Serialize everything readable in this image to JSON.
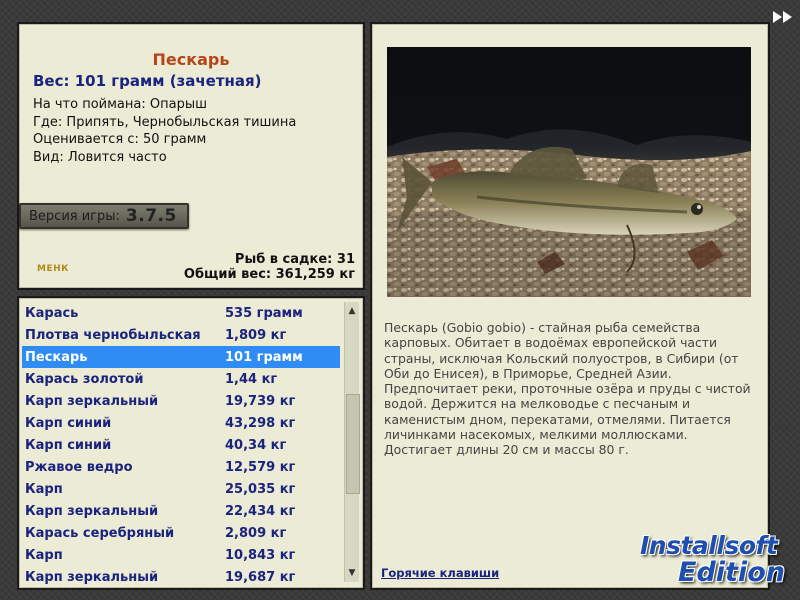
{
  "info": {
    "fish_name": "Пескарь",
    "weight_line": "Вес: 101 грамм (зачетная)",
    "caught_on": "На что поймана: Опарыш",
    "location": "Где: Припять, Чернобыльская тишина",
    "rated_from": "Оценивается с: 50 грамм",
    "frequency": "Вид: Ловится часто",
    "version_label": "Версия игры:",
    "version": "3.7.5",
    "fish_in_keepnet": "Рыб в садке: 31",
    "total_weight": "Общий вес: 361,259 кг",
    "logo_text": "МЕНК"
  },
  "catch_list": [
    {
      "name": "Карась",
      "weight": "535 грамм"
    },
    {
      "name": "Плотва чернобыльская",
      "weight": "1,809 кг"
    },
    {
      "name": "Пескарь",
      "weight": "101 грамм",
      "selected": true
    },
    {
      "name": "Карась золотой",
      "weight": "1,44 кг"
    },
    {
      "name": "Карп зеркальный",
      "weight": "19,739 кг"
    },
    {
      "name": "Карп синий",
      "weight": "43,298 кг"
    },
    {
      "name": "Карп синий",
      "weight": "40,34 кг"
    },
    {
      "name": "Ржавое ведро",
      "weight": "12,579 кг"
    },
    {
      "name": "Карп",
      "weight": "25,035 кг"
    },
    {
      "name": "Карп зеркальный",
      "weight": "22,434 кг"
    },
    {
      "name": "Карась серебряный",
      "weight": "2,809 кг"
    },
    {
      "name": "Карп",
      "weight": "10,843 кг"
    },
    {
      "name": "Карп зеркальный",
      "weight": "19,687 кг"
    }
  ],
  "detail": {
    "description": "Пескарь (Gobio gobio) - стайная рыба семейства карповых. Обитает в водоёмах европейской части страны, исключая Кольский полуостров, в Сибири (от Оби до Енисея), в Приморье, Средней Азии. Предпочитает реки, проточные озёра и пруды с чистой водой. Держится на мелководье с песчаным и каменистым дном, перекатами, отмелями. Питается личинками насекомых, мелкими моллюсками. Достигает длины 20 см и массы 80 г.",
    "hotkeys_link": "Горячие клавиши"
  },
  "watermark": {
    "line1": "Installsoft",
    "line2": "Edition"
  },
  "icons": {
    "fast_forward": "fast-forward-icon",
    "scroll_up": "arrow-up-icon",
    "scroll_down": "arrow-down-icon"
  }
}
